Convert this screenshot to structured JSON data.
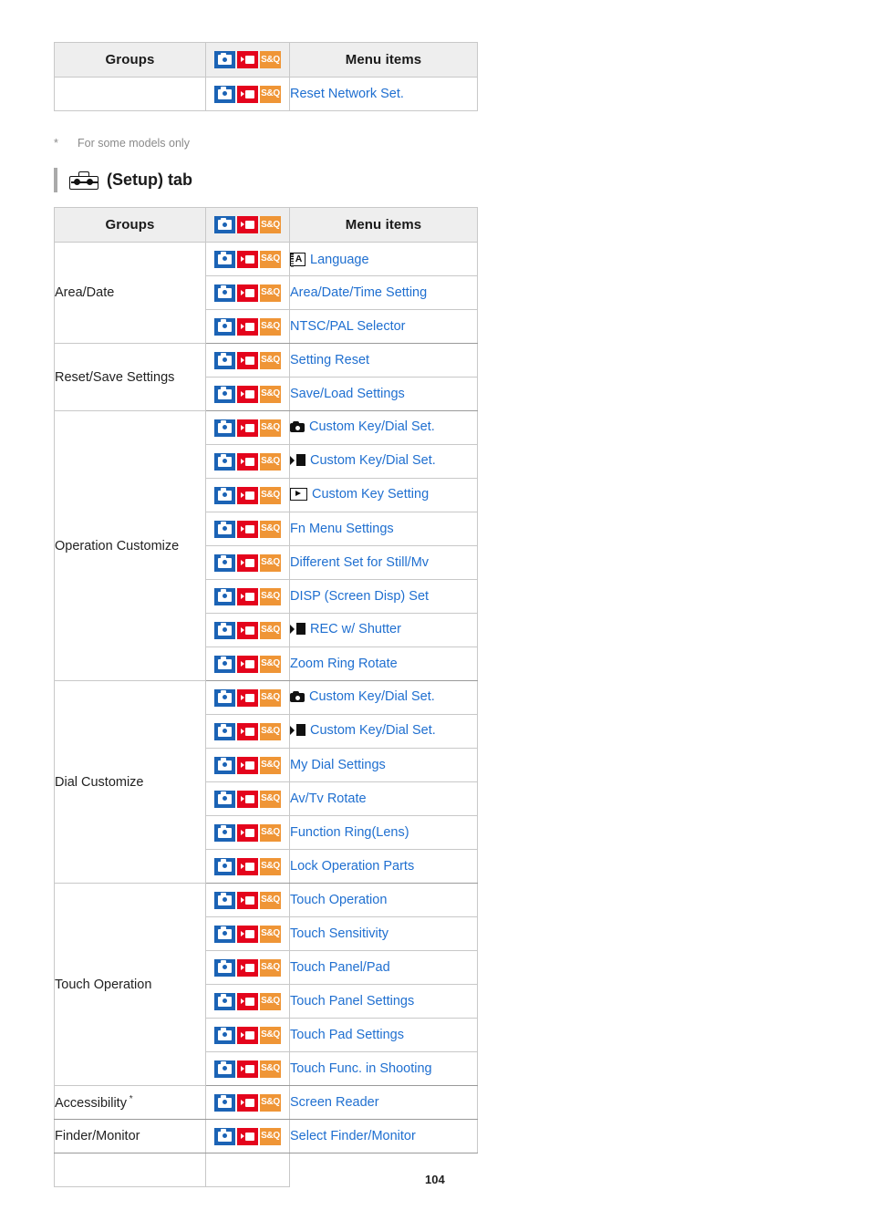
{
  "badge_colors": {
    "still": "#1b63b5",
    "movie": "#e4041c",
    "slow_quick": "#ef9536",
    "link": "#1f6fd0",
    "header_bg": "#eeeeee"
  },
  "top_table": {
    "headers": {
      "groups": "Groups",
      "badges": "badge-trio",
      "menu_items": "Menu items"
    },
    "rows": [
      {
        "group": "",
        "badges": [
          "still",
          "movie",
          "sq"
        ],
        "icon": "",
        "label": "Reset Network Set."
      }
    ]
  },
  "footnote": {
    "marker": "*",
    "text": "For some models only"
  },
  "section": {
    "icon": "toolbox-icon",
    "title": "(Setup) tab"
  },
  "setup_table": {
    "headers": {
      "groups": "Groups",
      "badges": "badge-trio",
      "menu_items": "Menu items"
    },
    "groups": [
      {
        "name": "Area/Date",
        "rows": [
          {
            "badges": [
              "still",
              "movie",
              "sq"
            ],
            "icon": "language-icon",
            "label": "Language"
          },
          {
            "badges": [
              "still",
              "movie",
              "sq"
            ],
            "icon": "",
            "label": "Area/Date/Time Setting"
          },
          {
            "badges": [
              "still",
              "movie",
              "sq"
            ],
            "icon": "",
            "label": "NTSC/PAL Selector"
          }
        ]
      },
      {
        "name": "Reset/Save Settings",
        "rows": [
          {
            "badges": [
              "still",
              "movie",
              "sq"
            ],
            "icon": "",
            "label": "Setting Reset"
          },
          {
            "badges": [
              "still",
              "movie",
              "sq"
            ],
            "icon": "",
            "label": "Save/Load Settings"
          }
        ]
      },
      {
        "name": "Operation Customize",
        "rows": [
          {
            "badges": [
              "still",
              "movie",
              "sq"
            ],
            "icon": "still-camera-icon",
            "label": "Custom Key/Dial Set."
          },
          {
            "badges": [
              "still",
              "movie",
              "sq"
            ],
            "icon": "movie-icon",
            "label": "Custom Key/Dial Set."
          },
          {
            "badges": [
              "still",
              "movie",
              "sq"
            ],
            "icon": "playback-icon",
            "label": "Custom Key Setting"
          },
          {
            "badges": [
              "still",
              "movie",
              "sq"
            ],
            "icon": "",
            "label": "Fn Menu Settings"
          },
          {
            "badges": [
              "still",
              "movie",
              "sq"
            ],
            "icon": "",
            "label": "Different Set for Still/Mv"
          },
          {
            "badges": [
              "still",
              "movie",
              "sq"
            ],
            "icon": "",
            "label": "DISP (Screen Disp) Set"
          },
          {
            "badges": [
              "still",
              "movie",
              "sq"
            ],
            "icon": "movie-icon",
            "label": "REC w/ Shutter"
          },
          {
            "badges": [
              "still",
              "movie",
              "sq"
            ],
            "icon": "",
            "label": "Zoom Ring Rotate"
          }
        ]
      },
      {
        "name": "Dial Customize",
        "rows": [
          {
            "badges": [
              "still",
              "movie",
              "sq"
            ],
            "icon": "still-camera-icon",
            "label": "Custom Key/Dial Set."
          },
          {
            "badges": [
              "still",
              "movie",
              "sq"
            ],
            "icon": "movie-icon",
            "label": "Custom Key/Dial Set."
          },
          {
            "badges": [
              "still",
              "movie",
              "sq"
            ],
            "icon": "",
            "label": "My Dial Settings"
          },
          {
            "badges": [
              "still",
              "movie",
              "sq"
            ],
            "icon": "",
            "label": "Av/Tv Rotate"
          },
          {
            "badges": [
              "still",
              "movie",
              "sq"
            ],
            "icon": "",
            "label": "Function Ring(Lens)"
          },
          {
            "badges": [
              "still",
              "movie",
              "sq"
            ],
            "icon": "",
            "label": "Lock Operation Parts"
          }
        ]
      },
      {
        "name": "Touch Operation",
        "rows": [
          {
            "badges": [
              "still",
              "movie",
              "sq"
            ],
            "icon": "",
            "label": "Touch Operation"
          },
          {
            "badges": [
              "still",
              "movie",
              "sq"
            ],
            "icon": "",
            "label": "Touch Sensitivity"
          },
          {
            "badges": [
              "still",
              "movie",
              "sq"
            ],
            "icon": "",
            "label": "Touch Panel/Pad"
          },
          {
            "badges": [
              "still",
              "movie",
              "sq"
            ],
            "icon": "",
            "label": "Touch Panel Settings"
          },
          {
            "badges": [
              "still",
              "movie",
              "sq"
            ],
            "icon": "",
            "label": "Touch Pad Settings"
          },
          {
            "badges": [
              "still",
              "movie",
              "sq"
            ],
            "icon": "",
            "label": "Touch Func. in Shooting"
          }
        ]
      },
      {
        "name": "Accessibility",
        "has_footnote_marker": true,
        "footnote_marker": "*",
        "rows": [
          {
            "badges": [
              "still",
              "movie",
              "sq"
            ],
            "icon": "",
            "label": "Screen Reader"
          }
        ]
      },
      {
        "name": "Finder/Monitor",
        "rows": [
          {
            "badges": [
              "still",
              "movie",
              "sq"
            ],
            "icon": "",
            "label": "Select Finder/Monitor"
          }
        ]
      }
    ]
  },
  "page_number": "104",
  "sq_label": "S&Q",
  "language_letter": "A"
}
